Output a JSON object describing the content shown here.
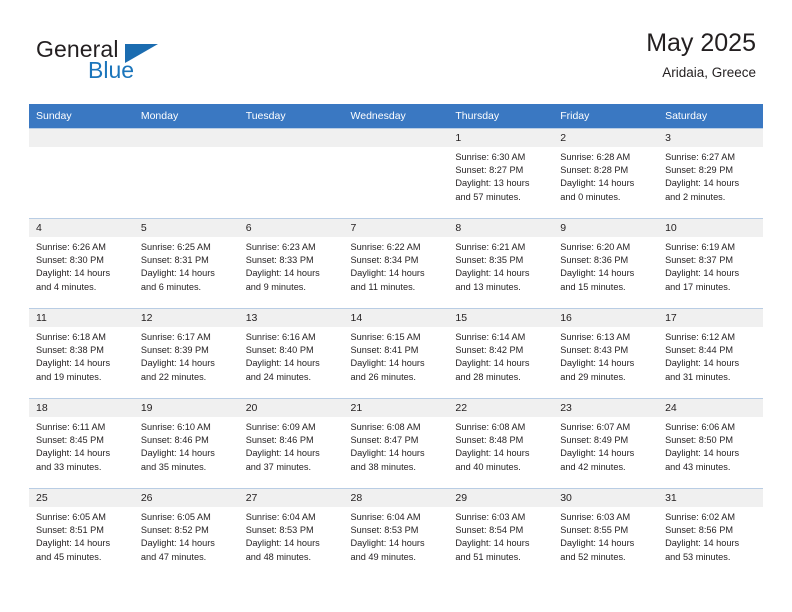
{
  "brand": {
    "name_part1": "General",
    "name_part2": "Blue",
    "logo_icon": "triangle-flag-icon",
    "accent_color": "#1b75bb"
  },
  "header": {
    "title": "May 2025",
    "subtitle": "Aridaia, Greece"
  },
  "theme": {
    "header_row_bg": "#3a78c2",
    "daynum_bg": "#f0f0f0",
    "grid_line": "#b9cde4",
    "text": "#231f20"
  },
  "weekdays": [
    "Sunday",
    "Monday",
    "Tuesday",
    "Wednesday",
    "Thursday",
    "Friday",
    "Saturday"
  ],
  "weeks": [
    [
      {
        "day": "",
        "sunrise": "",
        "sunset": "",
        "daylight1": "",
        "daylight2": "",
        "empty": true
      },
      {
        "day": "",
        "sunrise": "",
        "sunset": "",
        "daylight1": "",
        "daylight2": "",
        "empty": true
      },
      {
        "day": "",
        "sunrise": "",
        "sunset": "",
        "daylight1": "",
        "daylight2": "",
        "empty": true
      },
      {
        "day": "",
        "sunrise": "",
        "sunset": "",
        "daylight1": "",
        "daylight2": "",
        "empty": true
      },
      {
        "day": "1",
        "sunrise": "Sunrise: 6:30 AM",
        "sunset": "Sunset: 8:27 PM",
        "daylight1": "Daylight: 13 hours",
        "daylight2": "and 57 minutes."
      },
      {
        "day": "2",
        "sunrise": "Sunrise: 6:28 AM",
        "sunset": "Sunset: 8:28 PM",
        "daylight1": "Daylight: 14 hours",
        "daylight2": "and 0 minutes."
      },
      {
        "day": "3",
        "sunrise": "Sunrise: 6:27 AM",
        "sunset": "Sunset: 8:29 PM",
        "daylight1": "Daylight: 14 hours",
        "daylight2": "and 2 minutes."
      }
    ],
    [
      {
        "day": "4",
        "sunrise": "Sunrise: 6:26 AM",
        "sunset": "Sunset: 8:30 PM",
        "daylight1": "Daylight: 14 hours",
        "daylight2": "and 4 minutes."
      },
      {
        "day": "5",
        "sunrise": "Sunrise: 6:25 AM",
        "sunset": "Sunset: 8:31 PM",
        "daylight1": "Daylight: 14 hours",
        "daylight2": "and 6 minutes."
      },
      {
        "day": "6",
        "sunrise": "Sunrise: 6:23 AM",
        "sunset": "Sunset: 8:33 PM",
        "daylight1": "Daylight: 14 hours",
        "daylight2": "and 9 minutes."
      },
      {
        "day": "7",
        "sunrise": "Sunrise: 6:22 AM",
        "sunset": "Sunset: 8:34 PM",
        "daylight1": "Daylight: 14 hours",
        "daylight2": "and 11 minutes."
      },
      {
        "day": "8",
        "sunrise": "Sunrise: 6:21 AM",
        "sunset": "Sunset: 8:35 PM",
        "daylight1": "Daylight: 14 hours",
        "daylight2": "and 13 minutes."
      },
      {
        "day": "9",
        "sunrise": "Sunrise: 6:20 AM",
        "sunset": "Sunset: 8:36 PM",
        "daylight1": "Daylight: 14 hours",
        "daylight2": "and 15 minutes."
      },
      {
        "day": "10",
        "sunrise": "Sunrise: 6:19 AM",
        "sunset": "Sunset: 8:37 PM",
        "daylight1": "Daylight: 14 hours",
        "daylight2": "and 17 minutes."
      }
    ],
    [
      {
        "day": "11",
        "sunrise": "Sunrise: 6:18 AM",
        "sunset": "Sunset: 8:38 PM",
        "daylight1": "Daylight: 14 hours",
        "daylight2": "and 19 minutes."
      },
      {
        "day": "12",
        "sunrise": "Sunrise: 6:17 AM",
        "sunset": "Sunset: 8:39 PM",
        "daylight1": "Daylight: 14 hours",
        "daylight2": "and 22 minutes."
      },
      {
        "day": "13",
        "sunrise": "Sunrise: 6:16 AM",
        "sunset": "Sunset: 8:40 PM",
        "daylight1": "Daylight: 14 hours",
        "daylight2": "and 24 minutes."
      },
      {
        "day": "14",
        "sunrise": "Sunrise: 6:15 AM",
        "sunset": "Sunset: 8:41 PM",
        "daylight1": "Daylight: 14 hours",
        "daylight2": "and 26 minutes."
      },
      {
        "day": "15",
        "sunrise": "Sunrise: 6:14 AM",
        "sunset": "Sunset: 8:42 PM",
        "daylight1": "Daylight: 14 hours",
        "daylight2": "and 28 minutes."
      },
      {
        "day": "16",
        "sunrise": "Sunrise: 6:13 AM",
        "sunset": "Sunset: 8:43 PM",
        "daylight1": "Daylight: 14 hours",
        "daylight2": "and 29 minutes."
      },
      {
        "day": "17",
        "sunrise": "Sunrise: 6:12 AM",
        "sunset": "Sunset: 8:44 PM",
        "daylight1": "Daylight: 14 hours",
        "daylight2": "and 31 minutes."
      }
    ],
    [
      {
        "day": "18",
        "sunrise": "Sunrise: 6:11 AM",
        "sunset": "Sunset: 8:45 PM",
        "daylight1": "Daylight: 14 hours",
        "daylight2": "and 33 minutes."
      },
      {
        "day": "19",
        "sunrise": "Sunrise: 6:10 AM",
        "sunset": "Sunset: 8:46 PM",
        "daylight1": "Daylight: 14 hours",
        "daylight2": "and 35 minutes."
      },
      {
        "day": "20",
        "sunrise": "Sunrise: 6:09 AM",
        "sunset": "Sunset: 8:46 PM",
        "daylight1": "Daylight: 14 hours",
        "daylight2": "and 37 minutes."
      },
      {
        "day": "21",
        "sunrise": "Sunrise: 6:08 AM",
        "sunset": "Sunset: 8:47 PM",
        "daylight1": "Daylight: 14 hours",
        "daylight2": "and 38 minutes."
      },
      {
        "day": "22",
        "sunrise": "Sunrise: 6:08 AM",
        "sunset": "Sunset: 8:48 PM",
        "daylight1": "Daylight: 14 hours",
        "daylight2": "and 40 minutes."
      },
      {
        "day": "23",
        "sunrise": "Sunrise: 6:07 AM",
        "sunset": "Sunset: 8:49 PM",
        "daylight1": "Daylight: 14 hours",
        "daylight2": "and 42 minutes."
      },
      {
        "day": "24",
        "sunrise": "Sunrise: 6:06 AM",
        "sunset": "Sunset: 8:50 PM",
        "daylight1": "Daylight: 14 hours",
        "daylight2": "and 43 minutes."
      }
    ],
    [
      {
        "day": "25",
        "sunrise": "Sunrise: 6:05 AM",
        "sunset": "Sunset: 8:51 PM",
        "daylight1": "Daylight: 14 hours",
        "daylight2": "and 45 minutes."
      },
      {
        "day": "26",
        "sunrise": "Sunrise: 6:05 AM",
        "sunset": "Sunset: 8:52 PM",
        "daylight1": "Daylight: 14 hours",
        "daylight2": "and 47 minutes."
      },
      {
        "day": "27",
        "sunrise": "Sunrise: 6:04 AM",
        "sunset": "Sunset: 8:53 PM",
        "daylight1": "Daylight: 14 hours",
        "daylight2": "and 48 minutes."
      },
      {
        "day": "28",
        "sunrise": "Sunrise: 6:04 AM",
        "sunset": "Sunset: 8:53 PM",
        "daylight1": "Daylight: 14 hours",
        "daylight2": "and 49 minutes."
      },
      {
        "day": "29",
        "sunrise": "Sunrise: 6:03 AM",
        "sunset": "Sunset: 8:54 PM",
        "daylight1": "Daylight: 14 hours",
        "daylight2": "and 51 minutes."
      },
      {
        "day": "30",
        "sunrise": "Sunrise: 6:03 AM",
        "sunset": "Sunset: 8:55 PM",
        "daylight1": "Daylight: 14 hours",
        "daylight2": "and 52 minutes."
      },
      {
        "day": "31",
        "sunrise": "Sunrise: 6:02 AM",
        "sunset": "Sunset: 8:56 PM",
        "daylight1": "Daylight: 14 hours",
        "daylight2": "and 53 minutes."
      }
    ]
  ]
}
